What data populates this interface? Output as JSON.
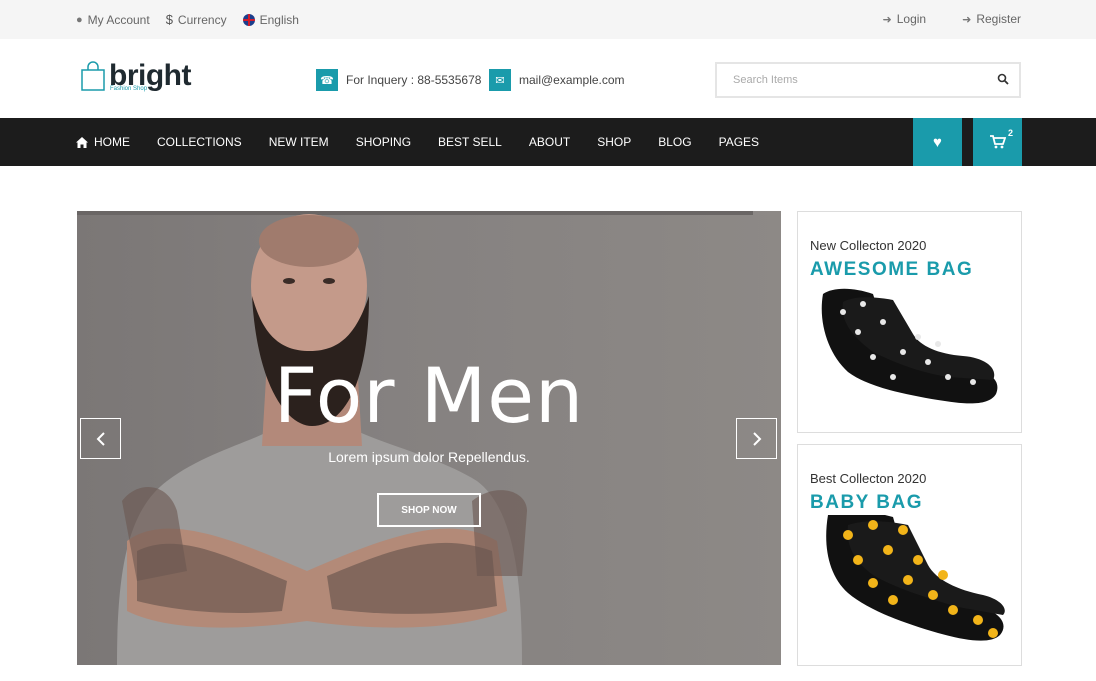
{
  "topbar": {
    "account": "My Account",
    "currency": "Currency",
    "language": "English",
    "login": "Login",
    "register": "Register"
  },
  "header": {
    "logo_text": "bright",
    "logo_tagline": "Fashion Shop",
    "inquiry": "For Inquery : 88-5535678",
    "email": "mail@example.com",
    "search_placeholder": "Search Items"
  },
  "nav": {
    "items": [
      "HOME",
      "COLLECTIONS",
      "NEW ITEM",
      "SHOPING",
      "BEST SELL",
      "ABOUT",
      "SHOP",
      "BLOG",
      "PAGES"
    ],
    "cart_count": "2"
  },
  "slider": {
    "title": "For Men",
    "subtitle": "Lorem ipsum dolor Repellendus.",
    "button": "SHOP NOW"
  },
  "banners": [
    {
      "subtitle": "New Collecton 2020",
      "title": "AWESOME BAG"
    },
    {
      "subtitle": "Best Collecton 2020",
      "title": "BABY BAG"
    }
  ],
  "colors": {
    "accent": "#1a9bab",
    "nav_bg": "#1c1c1c",
    "topbar_bg": "#f5f5f5"
  }
}
